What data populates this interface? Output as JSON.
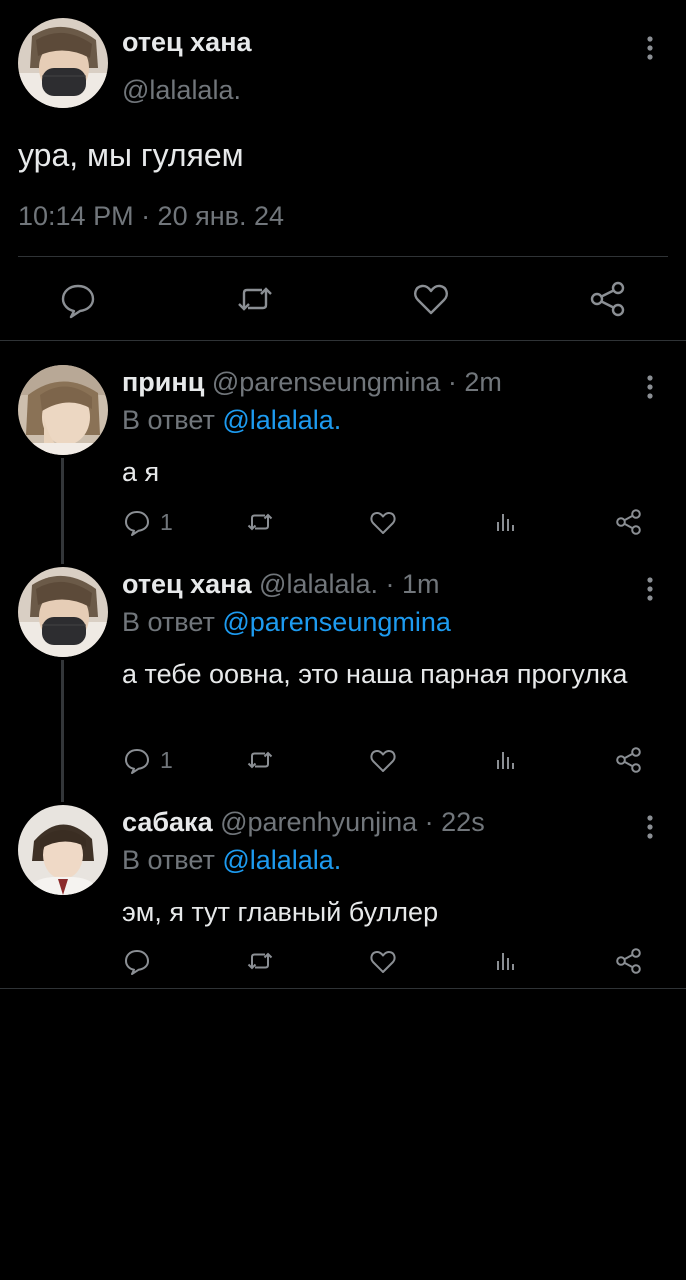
{
  "main_tweet": {
    "name": "отец хана",
    "handle": "@lalalala.",
    "text": "ура, мы гуляем",
    "timestamp": "10:14 PM · 20 янв. 24",
    "actions": [
      "reply-icon",
      "retweet-icon",
      "like-icon",
      "share-icon"
    ]
  },
  "replies": [
    {
      "name": "принц",
      "handle": "@parenseungmina",
      "time": "· 2m",
      "reply_prefix": "В ответ",
      "reply_to": "@lalalala.",
      "text": "а я",
      "reply_count": "1"
    },
    {
      "name": "отец хана",
      "handle": "@lalalala.",
      "time": "· 1m",
      "reply_prefix": "В ответ",
      "reply_to": "@parenseungmina",
      "text": "а тебе оовна, это наша парная прогулка",
      "reply_count": "1"
    },
    {
      "name": "сабака",
      "handle": "@parenhyunjina",
      "time": "· 22s",
      "reply_prefix": "В ответ",
      "reply_to": "@lalalala.",
      "text": "эм, я тут главный буллер",
      "reply_count": ""
    }
  ],
  "colors": {
    "background": "#000000",
    "text": "#e7e9ea",
    "secondary": "#71767b",
    "mention": "#1d9bf0",
    "divider": "#2f3336"
  }
}
